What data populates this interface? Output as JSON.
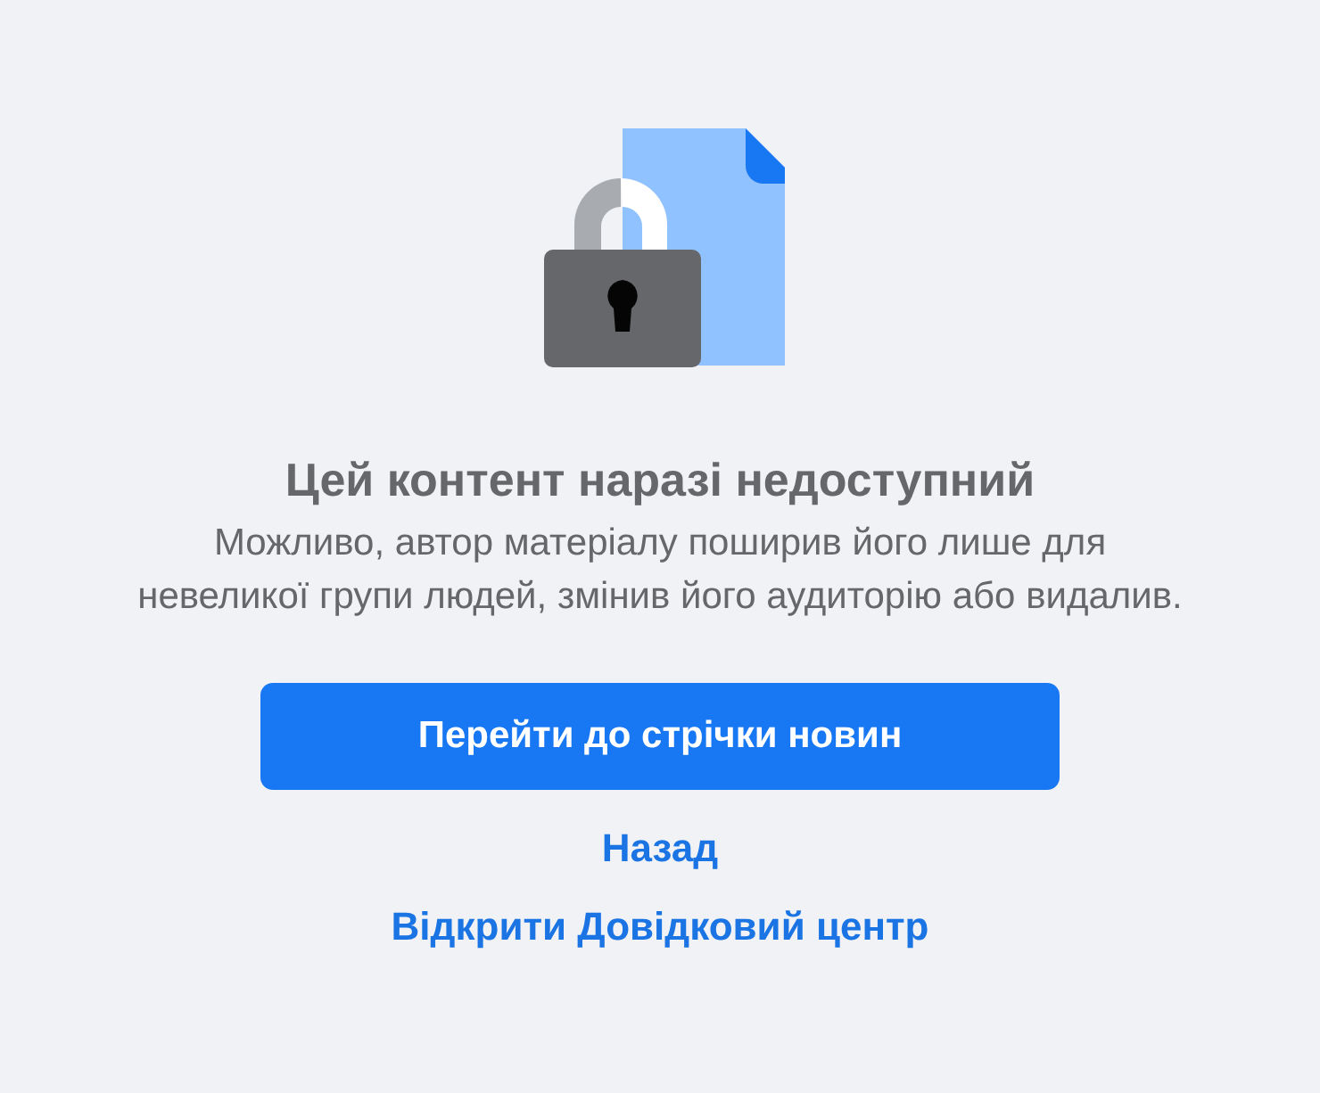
{
  "title": "Цей контент наразі недоступний",
  "message": "Можливо, автор матеріалу поширив його лише для невеликої групи людей, змінив його аудиторію або видалив.",
  "primary_button": "Перейти до стрічки новин",
  "links": [
    "Назад",
    "Відкрити Довідковий центр"
  ]
}
